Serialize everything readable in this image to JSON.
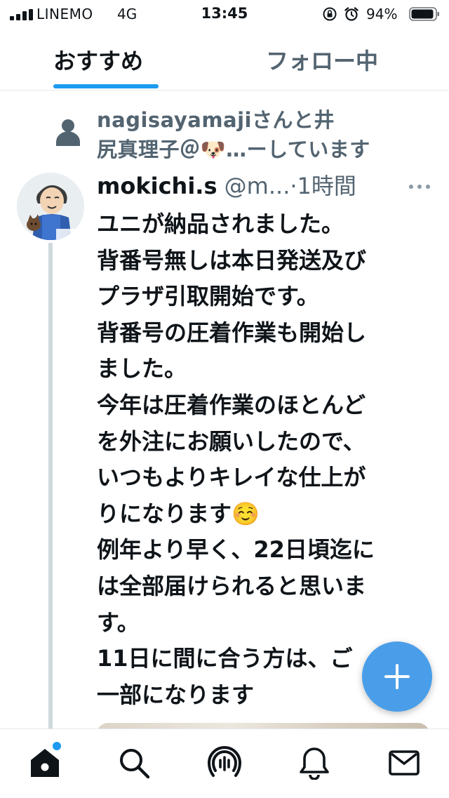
{
  "status_bar": {
    "carrier": "LINEMO",
    "network": "4G",
    "time": "13:45",
    "battery": "94%",
    "icons": [
      "signal-bars-icon",
      "orientation-lock-icon",
      "alarm-icon",
      "battery-icon"
    ]
  },
  "tabs": [
    {
      "label": "おすすめ",
      "active": true
    },
    {
      "label": "フォロー中",
      "active": false
    }
  ],
  "social_context": {
    "lines": [
      "nagisayamajiさんと井",
      "尻真理子＠🐶…ーしています"
    ],
    "icon": "person-icon"
  },
  "tweet": {
    "display_name": "mokichi.s",
    "handle": "@m...",
    "separator": "·",
    "timestamp": "1時間",
    "more_icon": "more-dots-icon",
    "body_lines": [
      "ユニが納品されました。",
      "背番号無しは本日発送及び",
      "プラザ引取開始です。",
      "背番号の圧着作業も開始し",
      "ました。",
      "今年は圧着作業のほとんど",
      "を外注にお願いしたので、",
      "いつもよりキレイな仕上が",
      "りになります☺️",
      "例年より早く、22日頃迄に",
      "は全部届けられると思いま",
      "す。",
      "11日に間に合う方は、ご",
      "一部になります"
    ]
  },
  "fab": {
    "icon": "plus-icon"
  },
  "bottom_nav": {
    "items": [
      "home-icon",
      "search-icon",
      "spaces-icon",
      "notifications-icon",
      "messages-icon"
    ],
    "accent_color": "#1d9bf0"
  },
  "colors": {
    "accent": "#1d9bf0",
    "fab": "#4a9ee9",
    "text_primary": "#0f1419",
    "text_secondary": "#536471"
  }
}
